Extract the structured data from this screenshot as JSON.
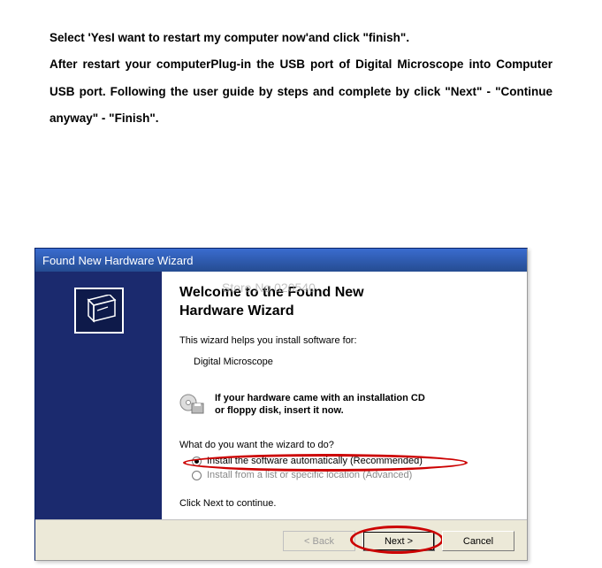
{
  "instructions": {
    "p1": "Select 'YesI want to restart my computer now'and click \"finish\".",
    "p2": "After restart your computerPlug-in the USB port of Digital Microscope into Computer USB port. Following the user guide by steps and complete by click \"Next\" - \"Continue anyway\" - \"Finish\"."
  },
  "dialog": {
    "title": "Found New Hardware Wizard",
    "heading_line1": "Welcome to the Found New",
    "heading_line2": "Hardware Wizard",
    "helps_text": "This wizard helps you install software for:",
    "device_name": "Digital Microscope",
    "cd_text_line1": "If your hardware came with an installation CD",
    "cd_text_line2": "or floppy disk, insert it now.",
    "prompt": "What do you want the wizard to do?",
    "opt_auto": "Install the software automatically (Recommended)",
    "opt_adv": "Install from a list or specific location (Advanced)",
    "click_next": "Click Next to continue.",
    "buttons": {
      "back": "< Back",
      "next": "Next >",
      "cancel": "Cancel"
    }
  },
  "watermark": "Store No.020540"
}
